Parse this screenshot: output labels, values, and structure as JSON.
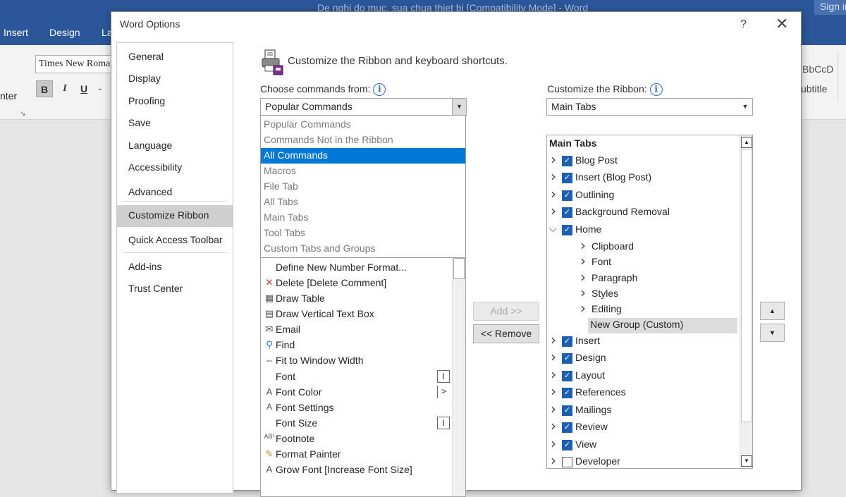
{
  "word": {
    "doc_title": "De nghi do muc, sua chua thiet bi [Compatibility Mode]  -  Word",
    "sign_in": "Sign in",
    "tabs": [
      "Insert",
      "Design",
      "La"
    ],
    "font_name": "Times New Roman",
    "format_buttons": [
      "B",
      "I",
      "U"
    ],
    "center_label": "nter",
    "style_sample": "BbCcD",
    "style_subtitle": "ubtitle"
  },
  "dialog": {
    "title": "Word Options",
    "help": "?",
    "close": "✕",
    "nav": [
      "General",
      "Display",
      "Proofing",
      "Save",
      "Language",
      "Accessibility",
      "Advanced",
      "Customize Ribbon",
      "Quick Access Toolbar",
      "Add-ins",
      "Trust Center"
    ],
    "nav_selected": "Customize Ribbon",
    "header_text": "Customize the Ribbon and keyboard shortcuts.",
    "choose_label": "Choose commands from:",
    "choose_value": "Popular Commands",
    "dropdown_options": [
      "Popular Commands",
      "Commands Not in the Ribbon",
      "All Commands",
      "Macros",
      "File Tab",
      "All Tabs",
      "Main Tabs",
      "Tool Tabs",
      "Custom Tabs and Groups"
    ],
    "dropdown_highlighted": "All Commands",
    "commands": [
      {
        "icon": "",
        "label": "Define New Number Format...",
        "extra": ""
      },
      {
        "icon": "delete-comment-icon",
        "label": "Delete [Delete Comment]",
        "extra": ""
      },
      {
        "icon": "draw-table-icon",
        "label": "Draw Table",
        "extra": ""
      },
      {
        "icon": "text-box-icon",
        "label": "Draw Vertical Text Box",
        "extra": ""
      },
      {
        "icon": "email-icon",
        "label": "Email",
        "extra": ""
      },
      {
        "icon": "find-icon",
        "label": "Find",
        "extra": ""
      },
      {
        "icon": "fit-width-icon",
        "label": "Fit to Window Width",
        "extra": ""
      },
      {
        "icon": "",
        "label": "Font",
        "extra": "I"
      },
      {
        "icon": "font-color-icon",
        "label": "Font Color",
        "extra": ">"
      },
      {
        "icon": "font-settings-icon",
        "label": "Font Settings",
        "extra": ""
      },
      {
        "icon": "",
        "label": "Font Size",
        "extra": "I"
      },
      {
        "icon": "footnote-icon",
        "label": "Footnote",
        "extra": ""
      },
      {
        "icon": "format-painter-icon",
        "label": "Format Painter",
        "extra": ""
      },
      {
        "icon": "grow-font-icon",
        "label": "Grow Font [Increase Font Size]",
        "extra": ""
      }
    ],
    "add_button": "Add >>",
    "remove_button": "<< Remove",
    "customize_label": "Customize the Ribbon:",
    "customize_value": "Main Tabs",
    "tree_header": "Main Tabs",
    "tree": [
      {
        "label": "Blog Post",
        "level": 0,
        "expanded": false,
        "checked": true
      },
      {
        "label": "Insert (Blog Post)",
        "level": 0,
        "expanded": false,
        "checked": true
      },
      {
        "label": "Outlining",
        "level": 0,
        "expanded": false,
        "checked": true
      },
      {
        "label": "Background Removal",
        "level": 0,
        "expanded": false,
        "checked": true
      },
      {
        "label": "Home",
        "level": 0,
        "expanded": true,
        "checked": true
      },
      {
        "label": "Clipboard",
        "level": 1,
        "expanded": false,
        "checked": null
      },
      {
        "label": "Font",
        "level": 1,
        "expanded": false,
        "checked": null
      },
      {
        "label": "Paragraph",
        "level": 1,
        "expanded": false,
        "checked": null
      },
      {
        "label": "Styles",
        "level": 1,
        "expanded": false,
        "checked": null
      },
      {
        "label": "Editing",
        "level": 1,
        "expanded": false,
        "checked": null
      },
      {
        "label": "New Group (Custom)",
        "level": 2,
        "expanded": null,
        "checked": null
      },
      {
        "label": "Insert",
        "level": 0,
        "expanded": false,
        "checked": true
      },
      {
        "label": "Design",
        "level": 0,
        "expanded": false,
        "checked": true
      },
      {
        "label": "Layout",
        "level": 0,
        "expanded": false,
        "checked": true
      },
      {
        "label": "References",
        "level": 0,
        "expanded": false,
        "checked": true
      },
      {
        "label": "Mailings",
        "level": 0,
        "expanded": false,
        "checked": true
      },
      {
        "label": "Review",
        "level": 0,
        "expanded": false,
        "checked": true
      },
      {
        "label": "View",
        "level": 0,
        "expanded": false,
        "checked": true
      },
      {
        "label": "Developer",
        "level": 0,
        "expanded": false,
        "checked": false
      }
    ],
    "move_up": "▲",
    "move_down": "▼"
  },
  "colors": {
    "word_blue": "#2b579a",
    "selection_blue": "#0078d7",
    "checkbox_blue": "#1c5fb0"
  }
}
